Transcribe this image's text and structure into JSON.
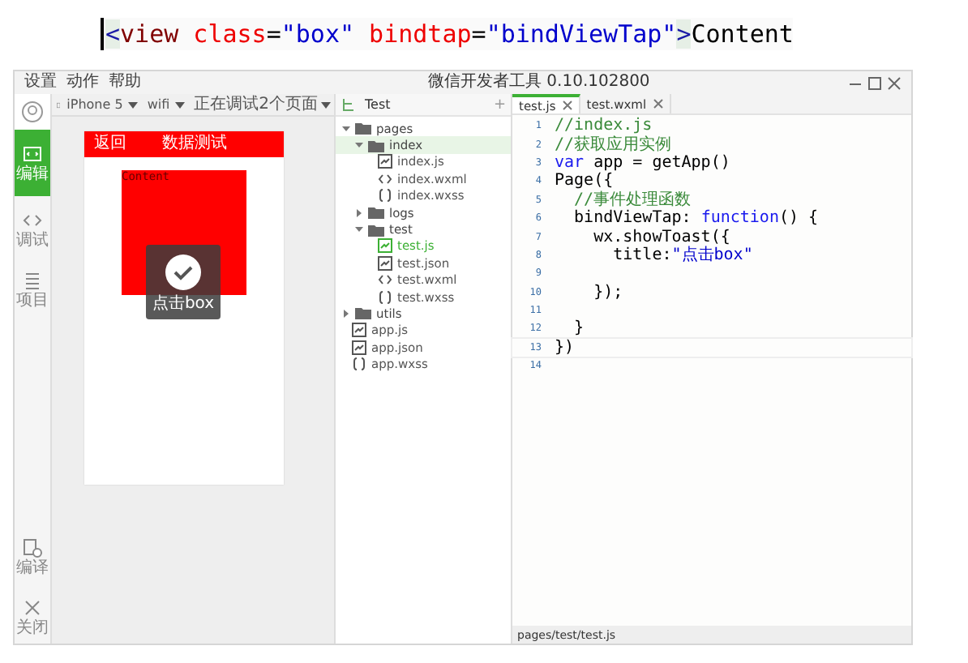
{
  "snippet": [
    {
      "text": "<",
      "kind": "bracket"
    },
    {
      "text": "view",
      "kind": "tag"
    },
    {
      "text": " class",
      "kind": "attr"
    },
    {
      "text": "=",
      "kind": "plain"
    },
    {
      "text": "\"box\"",
      "kind": "string"
    },
    {
      "text": " bindtap",
      "kind": "attr"
    },
    {
      "text": "=",
      "kind": "plain"
    },
    {
      "text": "\"bindViewTap\"",
      "kind": "string"
    },
    {
      "text": ">",
      "kind": "bracket"
    },
    {
      "text": "Content",
      "kind": "plain"
    }
  ],
  "window": {
    "title": "微信开发者工具 0.10.102800",
    "menu": [
      "设置",
      "动作",
      "帮助"
    ]
  },
  "sidebar": {
    "items": [
      {
        "label": "编辑",
        "selected": true
      },
      {
        "label": "调试",
        "selected": false
      },
      {
        "label": "项目",
        "selected": false
      }
    ],
    "bottom": [
      {
        "label": "编译"
      },
      {
        "label": "关闭"
      }
    ]
  },
  "toolbar": {
    "device": "iPhone 5",
    "network": "wifi",
    "debug": "正在调试2个页面"
  },
  "phone": {
    "back": "返回",
    "title": "数据测试",
    "box_text": "Content",
    "toast": "点击box"
  },
  "tree": {
    "project": "Test",
    "add": "+",
    "items": [
      {
        "name": "pages",
        "kind": "folder",
        "expanded": true,
        "selected": false,
        "children": [
          {
            "name": "index",
            "kind": "folder",
            "expanded": true,
            "selected": true,
            "children": [
              {
                "name": "index.js",
                "kind": "js",
                "open": false
              },
              {
                "name": "index.wxml",
                "kind": "markup",
                "open": false
              },
              {
                "name": "index.wxss",
                "kind": "style",
                "open": false
              }
            ]
          },
          {
            "name": "logs",
            "kind": "folder",
            "expanded": false,
            "selected": false
          },
          {
            "name": "test",
            "kind": "folder",
            "expanded": true,
            "selected": false,
            "children": [
              {
                "name": "test.js",
                "kind": "js",
                "open": true
              },
              {
                "name": "test.json",
                "kind": "js",
                "open": false
              },
              {
                "name": "test.wxml",
                "kind": "markup",
                "open": false
              },
              {
                "name": "test.wxss",
                "kind": "style",
                "open": false
              }
            ]
          }
        ]
      },
      {
        "name": "utils",
        "kind": "folder",
        "expanded": false,
        "selected": false
      },
      {
        "name": "app.js",
        "kind": "js",
        "open": false
      },
      {
        "name": "app.json",
        "kind": "js",
        "open": false
      },
      {
        "name": "app.wxss",
        "kind": "style",
        "open": false
      }
    ]
  },
  "tabs": [
    {
      "label": "test.js",
      "selected": true
    },
    {
      "label": "test.wxml",
      "selected": false
    }
  ],
  "code": [
    {
      "number": "1",
      "tokens": [
        {
          "text": "//index.js",
          "kind": "comment"
        }
      ]
    },
    {
      "number": "2",
      "tokens": [
        {
          "text": "//获取应用实例",
          "kind": "comment"
        }
      ]
    },
    {
      "number": "3",
      "tokens": [
        {
          "text": "var",
          "kind": "keyword"
        },
        {
          "text": " app = getApp()",
          "kind": "plain"
        }
      ]
    },
    {
      "number": "4",
      "tokens": [
        {
          "text": "Page({",
          "kind": "plain"
        }
      ]
    },
    {
      "number": "5",
      "tokens": [
        {
          "text": "  //事件处理函数",
          "kind": "comment"
        }
      ]
    },
    {
      "number": "6",
      "tokens": [
        {
          "text": "  bindViewTap: ",
          "kind": "plain"
        },
        {
          "text": "function",
          "kind": "keyword"
        },
        {
          "text": "() {",
          "kind": "plain"
        }
      ]
    },
    {
      "number": "7",
      "tokens": [
        {
          "text": "    wx.showToast({",
          "kind": "plain"
        }
      ]
    },
    {
      "number": "8",
      "tokens": [
        {
          "text": "      title:",
          "kind": "plain"
        },
        {
          "text": "\"点击box\"",
          "kind": "string"
        }
      ]
    },
    {
      "number": "9"
    },
    {
      "number": "10",
      "tokens": [
        {
          "text": "    });",
          "kind": "plain"
        }
      ]
    },
    {
      "number": "11"
    },
    {
      "number": "12",
      "tokens": [
        {
          "text": "  }",
          "kind": "plain"
        }
      ]
    },
    {
      "number": "13",
      "tokens": [
        {
          "text": "})",
          "kind": "plain"
        }
      ]
    },
    {
      "number": "14"
    }
  ],
  "status_bar": "pages/test/test.js"
}
